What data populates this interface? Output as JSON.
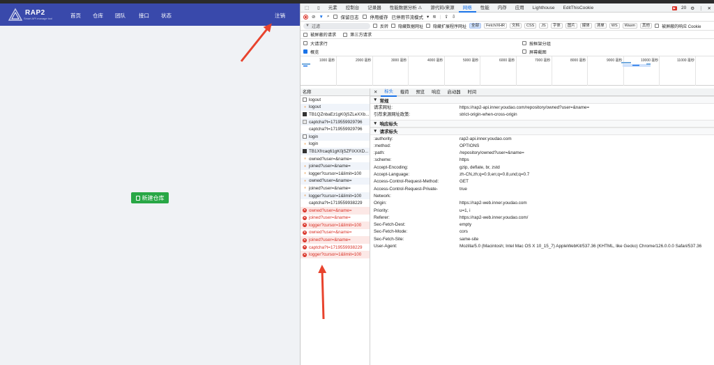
{
  "app": {
    "brand": "RAP2",
    "brand_sub": "Smart API manage tool",
    "nav": [
      "首页",
      "仓库",
      "团队",
      "接口",
      "状态"
    ],
    "logout": "注销",
    "new_repo": "新建仓库"
  },
  "devtools": {
    "tabs": [
      "元素",
      "控制台",
      "记录器",
      "性能数据分析 ⚠",
      "源代码/来源",
      "网络",
      "性能",
      "内存",
      "应用",
      "Lighthouse",
      "EditThisCookie"
    ],
    "active_tab": "网络",
    "issues_count": "20",
    "toolbar": {
      "preserve_log": "保留日志",
      "disable_cache": "停用缓存",
      "throttle": "已停用节流模式"
    },
    "filter": {
      "placeholder": "过滤",
      "invert": "反转",
      "hide_data_urls": "隐藏数据网址",
      "hide_ext_urls": "隐藏扩展程序网址",
      "chips": [
        "全部",
        "Fetch/XHR",
        "文档",
        "CSS",
        "JS",
        "字体",
        "图片",
        "媒体",
        "清单",
        "WS",
        "Wasm",
        "其他"
      ],
      "blocked_cookie": "被屏蔽的响应 Cookie",
      "blocked_requests": "被屏蔽的请求",
      "third_party": "第三方请求"
    },
    "options": {
      "big_rows": "大请求行",
      "group_by_frame": "按框架分组",
      "overview": "概览",
      "screenshots": "屏幕截图"
    },
    "timeline_ticks": [
      "1000 毫秒",
      "2000 毫秒",
      "3000 毫秒",
      "4000 毫秒",
      "5000 毫秒",
      "6000 毫秒",
      "7000 毫秒",
      "8000 毫秒",
      "9000 毫秒",
      "10000 毫秒",
      "11000 毫秒"
    ],
    "list_header": "名称",
    "requests": [
      {
        "name": "logout",
        "icon": "doc",
        "error": false
      },
      {
        "name": "logout",
        "icon": "xhr",
        "error": false
      },
      {
        "name": "TB1QZnbaEz1gK0jSZLeXXb...",
        "icon": "img",
        "error": false
      },
      {
        "name": "captcha?t=1719559929796",
        "icon": "js",
        "error": false
      },
      {
        "name": "captcha?t=1719559929796",
        "icon": "none",
        "error": false
      },
      {
        "name": "login",
        "icon": "doc",
        "error": false
      },
      {
        "name": "login",
        "icon": "xhr",
        "error": false
      },
      {
        "name": "TB1Xfrcaq61gK0jSZFIXXXD...",
        "icon": "img",
        "error": false
      },
      {
        "name": "owned?user=&name=",
        "icon": "xhr",
        "error": false
      },
      {
        "name": "joined?user=&name=",
        "icon": "xhr",
        "error": false
      },
      {
        "name": "logger?cursor=1&limit=100",
        "icon": "xhr",
        "error": false
      },
      {
        "name": "owned?user=&name=",
        "icon": "xhr",
        "error": false
      },
      {
        "name": "joined?user=&name=",
        "icon": "xhr",
        "error": false
      },
      {
        "name": "logger?cursor=1&limit=100",
        "icon": "xhr",
        "error": false
      },
      {
        "name": "captcha?t=1719559938229",
        "icon": "none",
        "error": false
      },
      {
        "name": "owned?user=&name=",
        "icon": "err",
        "error": true
      },
      {
        "name": "joined?user=&name=",
        "icon": "err",
        "error": true
      },
      {
        "name": "logger?cursor=1&limit=100",
        "icon": "err",
        "error": true
      },
      {
        "name": "owned?user=&name=",
        "icon": "err",
        "error": true
      },
      {
        "name": "joined?user=&name=",
        "icon": "err",
        "error": true
      },
      {
        "name": "captcha?t=1719559938229",
        "icon": "err",
        "error": true
      },
      {
        "name": "logger?cursor=1&limit=100",
        "icon": "err",
        "error": true
      }
    ],
    "detail_tabs": [
      "标头",
      "载荷",
      "预览",
      "响应",
      "启动器",
      "时间"
    ],
    "general_title": "常规",
    "general": [
      {
        "k": "请求网址:",
        "v": "https://rap2-api.inner.youdao.com/repository/owned?user=&name="
      },
      {
        "k": "引荐来源网址政策:",
        "v": "strict-origin-when-cross-origin"
      }
    ],
    "response_title": "响应标头",
    "request_title": "请求标头",
    "request_headers": [
      {
        "k": ":authority:",
        "v": "rap2-api.inner.youdao.com"
      },
      {
        "k": ":method:",
        "v": "OPTIONS"
      },
      {
        "k": ":path:",
        "v": "/repository/owned?user=&name="
      },
      {
        "k": ":scheme:",
        "v": "https"
      },
      {
        "k": "Accept-Encoding:",
        "v": "gzip, deflate, br, zstd"
      },
      {
        "k": "Accept-Language:",
        "v": "zh-CN,zh;q=0.9,en;q=0.8,und;q=0.7"
      },
      {
        "k": "Access-Control-Request-Method:",
        "v": "GET"
      },
      {
        "k": "Access-Control-Request-Private-",
        "v": "true"
      },
      {
        "k": "Network:",
        "v": ""
      },
      {
        "k": "Origin:",
        "v": "https://rap2-web.inner.youdao.com"
      },
      {
        "k": "Priority:",
        "v": "u=1, i"
      },
      {
        "k": "Referer:",
        "v": "https://rap2-web.inner.youdao.com/"
      },
      {
        "k": "Sec-Fetch-Dest:",
        "v": "empty"
      },
      {
        "k": "Sec-Fetch-Mode:",
        "v": "cors"
      },
      {
        "k": "Sec-Fetch-Site:",
        "v": "same-site"
      },
      {
        "k": "User-Agent:",
        "v": "Mozilla/5.0 (Macintosh; Intel Mac OS X 10_15_7) AppleWebKit/537.36 (KHTML, like Gecko) Chrome/126.0.0.0 Safari/537.36"
      }
    ]
  },
  "colors": {
    "appbar": "#3949ab",
    "new_repo": "#28a745",
    "error": "#d93025",
    "annotation_arrow": "#e8432d"
  }
}
